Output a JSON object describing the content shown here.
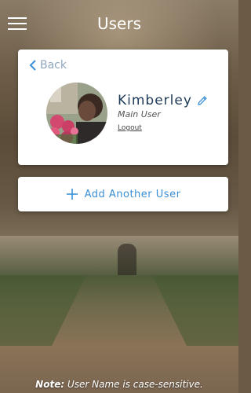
{
  "header": {
    "title": "Users",
    "menu_icon": "hamburger-menu-icon"
  },
  "profile_card": {
    "back_label": "Back",
    "back_icon": "chevron-left-icon",
    "user_name": "Kimberley",
    "edit_icon": "pencil-icon",
    "user_role": "Main User",
    "logout_label": "Logout"
  },
  "add_user": {
    "label": "Add Another User",
    "icon": "plus-icon"
  },
  "footer": {
    "note_prefix": "Note:",
    "note_text": " User Name is case-sensitive."
  },
  "colors": {
    "accent": "#3b8fd6",
    "name_text": "#1f3a57",
    "back_text": "#8fa6bf"
  }
}
